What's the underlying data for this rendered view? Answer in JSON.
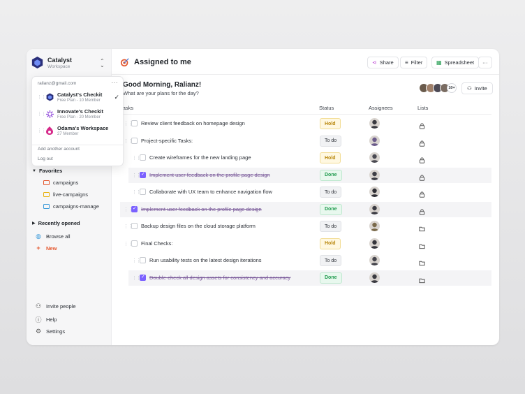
{
  "workspace": {
    "name": "Catalyst",
    "subtitle": "Workspace"
  },
  "dropdown": {
    "email": "ralianz@gmail.com",
    "workspaces": [
      {
        "name": "Catalyst's Checkit",
        "plan": "Free Plan - 10 Member",
        "selected": true
      },
      {
        "name": "Innovate's Checkit",
        "plan": "Free Plan - 20 Member",
        "selected": false
      },
      {
        "name": "Odama's Workspace",
        "plan": "27 Member",
        "selected": false
      }
    ],
    "add_account": "Add another account",
    "logout": "Log out"
  },
  "sidebar": {
    "favorites_label": "Favorites",
    "favorites": [
      {
        "label": "campaigns",
        "color": "#e4572e"
      },
      {
        "label": "live-campaigns",
        "color": "#e8b10c"
      },
      {
        "label": "campaigns-manage",
        "color": "#3b9ad9"
      }
    ],
    "recent_label": "Recently opened",
    "browse_all": "Browse all",
    "new_label": "New",
    "invite_people": "Invite people",
    "help": "Help",
    "settings": "Settings"
  },
  "header": {
    "title": "Assigned to me",
    "share": "Share",
    "filter": "Filter",
    "spreadsheet": "Spreadsheet"
  },
  "greeting": {
    "title": "Good Morning, Ralianz!",
    "subtitle": "What are your plans for the day?",
    "more_count": "10+",
    "invite": "Invite"
  },
  "table": {
    "columns": [
      "Tasks",
      "Status",
      "Assignees",
      "Lists"
    ],
    "rows": [
      {
        "task": "Review client feedback on homepage design",
        "status": "Hold",
        "done": false,
        "indent": false,
        "list_icon": "lock"
      },
      {
        "task": "Project-specific Tasks:",
        "status": "To do",
        "done": false,
        "indent": false,
        "list_icon": "lock"
      },
      {
        "task": "Create wireframes for the new landing page",
        "status": "Hold",
        "done": false,
        "indent": true,
        "list_icon": "lock"
      },
      {
        "task": "Implement user feedback on the profile page design",
        "status": "Done",
        "done": true,
        "indent": true,
        "list_icon": "lock"
      },
      {
        "task": "Collaborate with UX team to enhance navigation flow",
        "status": "To do",
        "done": false,
        "indent": true,
        "list_icon": "lock"
      },
      {
        "task": "Implement user feedback on the profile page design",
        "status": "Done",
        "done": true,
        "indent": false,
        "list_icon": "lock"
      },
      {
        "task": "Backup design files on the cloud storage platform",
        "status": "To do",
        "done": false,
        "indent": false,
        "list_icon": "folder"
      },
      {
        "task": "Final Checks:",
        "status": "Hold",
        "done": false,
        "indent": false,
        "list_icon": "folder"
      },
      {
        "task": "Run usability tests on the latest design iterations",
        "status": "To do",
        "done": false,
        "indent": true,
        "list_icon": "folder"
      },
      {
        "task": "Double-check all design assets for consistency and accuracy",
        "status": "Done",
        "done": true,
        "indent": true,
        "list_icon": "folder"
      }
    ]
  }
}
